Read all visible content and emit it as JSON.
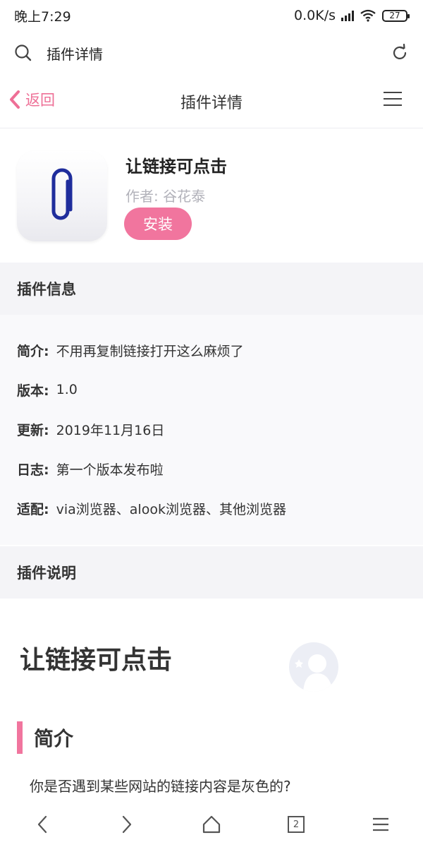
{
  "status_bar": {
    "time": "晚上7:29",
    "network_speed": "0.0K/s",
    "battery": "27"
  },
  "search_bar": {
    "text": "插件详情",
    "search_icon": "search-icon",
    "refresh_icon": "refresh-icon"
  },
  "nav": {
    "back_label": "返回",
    "title": "插件详情",
    "menu_icon": "hamburger-menu-icon"
  },
  "plugin": {
    "name": "让链接可点击",
    "author": "作者: 谷花泰",
    "install_label": "安装",
    "icon": "paperclip-icon"
  },
  "info_section": {
    "title": "插件信息",
    "rows": [
      {
        "label": "简介:",
        "value": "不用再复制链接打开这么麻烦了"
      },
      {
        "label": "版本:",
        "value": "1.0"
      },
      {
        "label": "更新:",
        "value": "2019年11月16日"
      },
      {
        "label": "日志:",
        "value": "第一个版本发布啦"
      },
      {
        "label": "适配:",
        "value": "via浏览器、alook浏览器、其他浏览器"
      }
    ]
  },
  "desc_section": {
    "title": "插件说明",
    "heading": "让链接可点击",
    "subheading": "简介",
    "text": "你是否遇到某些网站的链接内容是灰色的?"
  },
  "bottom_nav": {
    "tab_count": "2"
  },
  "colors": {
    "accent": "#f1759e",
    "paperclip": "#1f2d9c",
    "section_bg": "#f4f4f7"
  }
}
